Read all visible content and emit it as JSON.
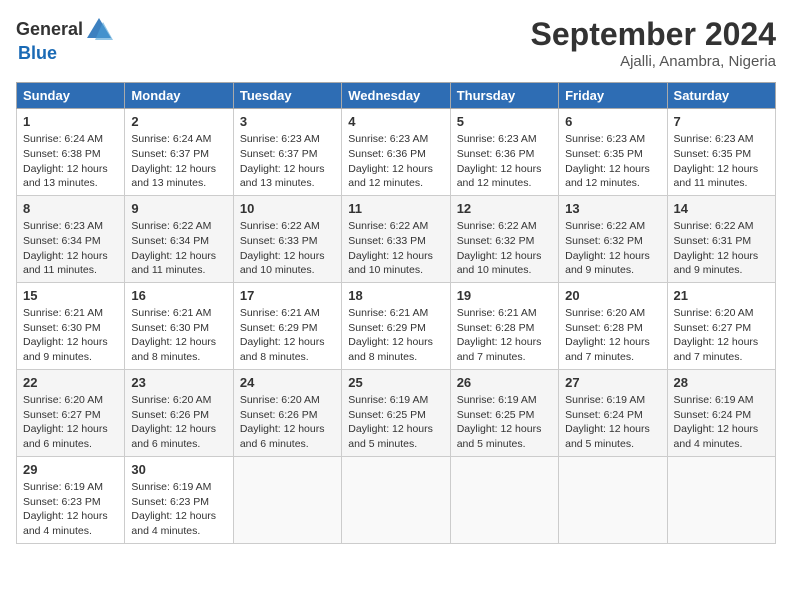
{
  "header": {
    "logo_general": "General",
    "logo_blue": "Blue",
    "month": "September 2024",
    "location": "Ajalli, Anambra, Nigeria"
  },
  "days_of_week": [
    "Sunday",
    "Monday",
    "Tuesday",
    "Wednesday",
    "Thursday",
    "Friday",
    "Saturday"
  ],
  "weeks": [
    [
      {
        "day": "1",
        "lines": [
          "Sunrise: 6:24 AM",
          "Sunset: 6:38 PM",
          "Daylight: 12 hours",
          "and 13 minutes."
        ]
      },
      {
        "day": "2",
        "lines": [
          "Sunrise: 6:24 AM",
          "Sunset: 6:37 PM",
          "Daylight: 12 hours",
          "and 13 minutes."
        ]
      },
      {
        "day": "3",
        "lines": [
          "Sunrise: 6:23 AM",
          "Sunset: 6:37 PM",
          "Daylight: 12 hours",
          "and 13 minutes."
        ]
      },
      {
        "day": "4",
        "lines": [
          "Sunrise: 6:23 AM",
          "Sunset: 6:36 PM",
          "Daylight: 12 hours",
          "and 12 minutes."
        ]
      },
      {
        "day": "5",
        "lines": [
          "Sunrise: 6:23 AM",
          "Sunset: 6:36 PM",
          "Daylight: 12 hours",
          "and 12 minutes."
        ]
      },
      {
        "day": "6",
        "lines": [
          "Sunrise: 6:23 AM",
          "Sunset: 6:35 PM",
          "Daylight: 12 hours",
          "and 12 minutes."
        ]
      },
      {
        "day": "7",
        "lines": [
          "Sunrise: 6:23 AM",
          "Sunset: 6:35 PM",
          "Daylight: 12 hours",
          "and 11 minutes."
        ]
      }
    ],
    [
      {
        "day": "8",
        "lines": [
          "Sunrise: 6:23 AM",
          "Sunset: 6:34 PM",
          "Daylight: 12 hours",
          "and 11 minutes."
        ]
      },
      {
        "day": "9",
        "lines": [
          "Sunrise: 6:22 AM",
          "Sunset: 6:34 PM",
          "Daylight: 12 hours",
          "and 11 minutes."
        ]
      },
      {
        "day": "10",
        "lines": [
          "Sunrise: 6:22 AM",
          "Sunset: 6:33 PM",
          "Daylight: 12 hours",
          "and 10 minutes."
        ]
      },
      {
        "day": "11",
        "lines": [
          "Sunrise: 6:22 AM",
          "Sunset: 6:33 PM",
          "Daylight: 12 hours",
          "and 10 minutes."
        ]
      },
      {
        "day": "12",
        "lines": [
          "Sunrise: 6:22 AM",
          "Sunset: 6:32 PM",
          "Daylight: 12 hours",
          "and 10 minutes."
        ]
      },
      {
        "day": "13",
        "lines": [
          "Sunrise: 6:22 AM",
          "Sunset: 6:32 PM",
          "Daylight: 12 hours",
          "and 9 minutes."
        ]
      },
      {
        "day": "14",
        "lines": [
          "Sunrise: 6:22 AM",
          "Sunset: 6:31 PM",
          "Daylight: 12 hours",
          "and 9 minutes."
        ]
      }
    ],
    [
      {
        "day": "15",
        "lines": [
          "Sunrise: 6:21 AM",
          "Sunset: 6:30 PM",
          "Daylight: 12 hours",
          "and 9 minutes."
        ]
      },
      {
        "day": "16",
        "lines": [
          "Sunrise: 6:21 AM",
          "Sunset: 6:30 PM",
          "Daylight: 12 hours",
          "and 8 minutes."
        ]
      },
      {
        "day": "17",
        "lines": [
          "Sunrise: 6:21 AM",
          "Sunset: 6:29 PM",
          "Daylight: 12 hours",
          "and 8 minutes."
        ]
      },
      {
        "day": "18",
        "lines": [
          "Sunrise: 6:21 AM",
          "Sunset: 6:29 PM",
          "Daylight: 12 hours",
          "and 8 minutes."
        ]
      },
      {
        "day": "19",
        "lines": [
          "Sunrise: 6:21 AM",
          "Sunset: 6:28 PM",
          "Daylight: 12 hours",
          "and 7 minutes."
        ]
      },
      {
        "day": "20",
        "lines": [
          "Sunrise: 6:20 AM",
          "Sunset: 6:28 PM",
          "Daylight: 12 hours",
          "and 7 minutes."
        ]
      },
      {
        "day": "21",
        "lines": [
          "Sunrise: 6:20 AM",
          "Sunset: 6:27 PM",
          "Daylight: 12 hours",
          "and 7 minutes."
        ]
      }
    ],
    [
      {
        "day": "22",
        "lines": [
          "Sunrise: 6:20 AM",
          "Sunset: 6:27 PM",
          "Daylight: 12 hours",
          "and 6 minutes."
        ]
      },
      {
        "day": "23",
        "lines": [
          "Sunrise: 6:20 AM",
          "Sunset: 6:26 PM",
          "Daylight: 12 hours",
          "and 6 minutes."
        ]
      },
      {
        "day": "24",
        "lines": [
          "Sunrise: 6:20 AM",
          "Sunset: 6:26 PM",
          "Daylight: 12 hours",
          "and 6 minutes."
        ]
      },
      {
        "day": "25",
        "lines": [
          "Sunrise: 6:19 AM",
          "Sunset: 6:25 PM",
          "Daylight: 12 hours",
          "and 5 minutes."
        ]
      },
      {
        "day": "26",
        "lines": [
          "Sunrise: 6:19 AM",
          "Sunset: 6:25 PM",
          "Daylight: 12 hours",
          "and 5 minutes."
        ]
      },
      {
        "day": "27",
        "lines": [
          "Sunrise: 6:19 AM",
          "Sunset: 6:24 PM",
          "Daylight: 12 hours",
          "and 5 minutes."
        ]
      },
      {
        "day": "28",
        "lines": [
          "Sunrise: 6:19 AM",
          "Sunset: 6:24 PM",
          "Daylight: 12 hours",
          "and 4 minutes."
        ]
      }
    ],
    [
      {
        "day": "29",
        "lines": [
          "Sunrise: 6:19 AM",
          "Sunset: 6:23 PM",
          "Daylight: 12 hours",
          "and 4 minutes."
        ]
      },
      {
        "day": "30",
        "lines": [
          "Sunrise: 6:19 AM",
          "Sunset: 6:23 PM",
          "Daylight: 12 hours",
          "and 4 minutes."
        ]
      },
      {
        "day": "",
        "lines": []
      },
      {
        "day": "",
        "lines": []
      },
      {
        "day": "",
        "lines": []
      },
      {
        "day": "",
        "lines": []
      },
      {
        "day": "",
        "lines": []
      }
    ]
  ]
}
